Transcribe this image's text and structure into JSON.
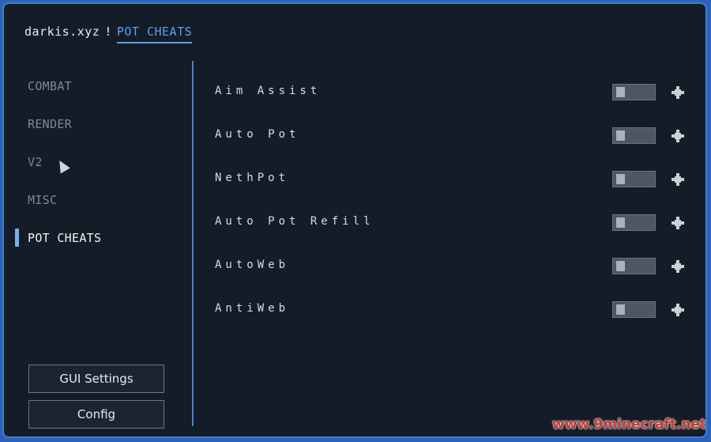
{
  "title": {
    "brand": "darkis.xyz",
    "separator": "!",
    "active_tab": "POT CHEATS"
  },
  "sidebar": {
    "categories": [
      {
        "label": "COMBAT",
        "selected": false
      },
      {
        "label": "RENDER",
        "selected": false
      },
      {
        "label": "V2",
        "selected": false
      },
      {
        "label": "MISC",
        "selected": false
      },
      {
        "label": "POT CHEATS",
        "selected": true
      }
    ],
    "buttons": {
      "gui_settings": "GUI Settings",
      "config": "Config"
    }
  },
  "modules": [
    {
      "name": "Aim Assist",
      "enabled": false
    },
    {
      "name": "Auto Pot",
      "enabled": false
    },
    {
      "name": "NethPot",
      "enabled": false
    },
    {
      "name": "Auto Pot Refill",
      "enabled": false
    },
    {
      "name": "AutoWeb",
      "enabled": false
    },
    {
      "name": "AntiWeb",
      "enabled": false
    }
  ],
  "icons": {
    "module_handle": "move-icon",
    "pointer": "cursor-icon"
  },
  "colors": {
    "frame_border": "#3f7fd0",
    "background": "#141c28",
    "accent": "#5aa2ea",
    "selected_bar": "#7aaef0"
  },
  "watermark": "www.9minecraft.net"
}
